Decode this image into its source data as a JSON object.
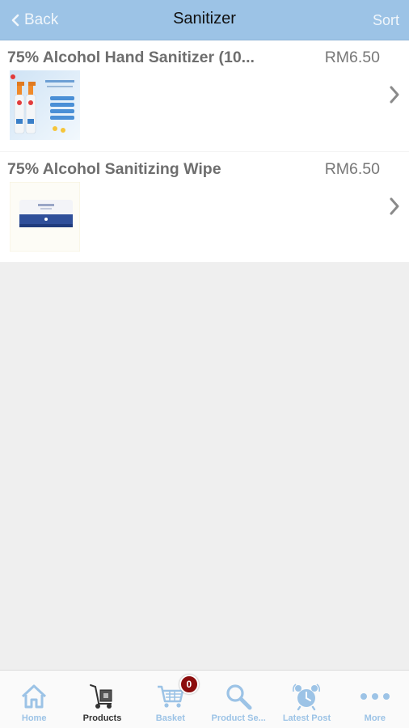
{
  "navbar": {
    "back_label": "Back",
    "title": "Sanitizer",
    "sort_label": "Sort"
  },
  "products": [
    {
      "name": "75% Alcohol Hand Sanitizer (10...",
      "price": "RM6.50",
      "image": "hand-sanitizer-spray-bottles"
    },
    {
      "name": "75% Alcohol Sanitizing Wipe",
      "price": "RM6.50",
      "image": "sanitizing-wipes-pack"
    }
  ],
  "tabbar": {
    "tabs": [
      {
        "label": "Home",
        "icon": "home-icon",
        "active": false
      },
      {
        "label": "Products",
        "icon": "products-cart-icon",
        "active": true
      },
      {
        "label": "Basket",
        "icon": "basket-icon",
        "active": false,
        "badge": "0"
      },
      {
        "label": "Product Se...",
        "icon": "search-icon",
        "active": false
      },
      {
        "label": "Latest Post",
        "icon": "alarm-clock-icon",
        "active": false
      },
      {
        "label": "More",
        "icon": "more-dots-icon",
        "active": false
      }
    ]
  },
  "colors": {
    "navbar_bg": "#9cc3e6",
    "tab_inactive": "#9cc3e6",
    "badge_bg": "#8b0d0d",
    "background": "#efefef"
  }
}
